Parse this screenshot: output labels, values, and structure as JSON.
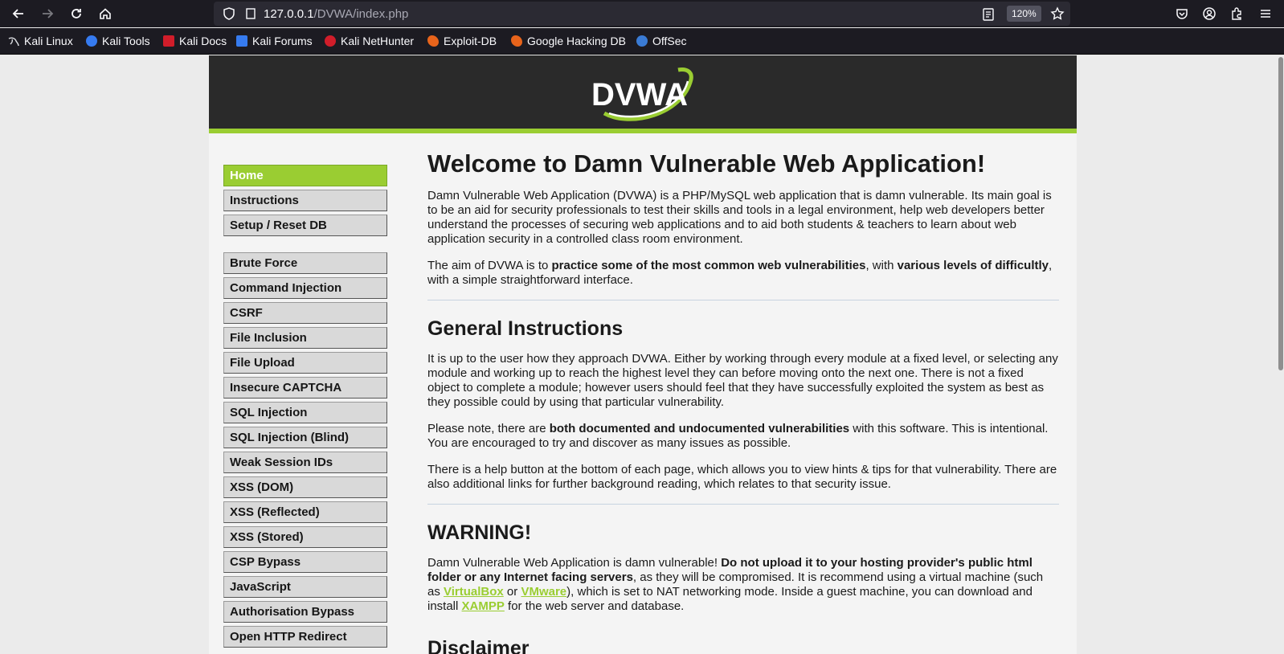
{
  "browser": {
    "url_host": "127.0.0.1",
    "url_path": "/DVWA/index.php",
    "zoom": "120%",
    "bookmarks": [
      {
        "label": "Kali Linux",
        "icon": "kali-dragon-icon"
      },
      {
        "label": "Kali Tools",
        "icon": "kali-tools-icon"
      },
      {
        "label": "Kali Docs",
        "icon": "kali-docs-icon"
      },
      {
        "label": "Kali Forums",
        "icon": "kali-forums-icon"
      },
      {
        "label": "Kali NetHunter",
        "icon": "nethunter-icon"
      },
      {
        "label": "Exploit-DB",
        "icon": "exploit-db-icon"
      },
      {
        "label": "Google Hacking DB",
        "icon": "ghdb-icon"
      },
      {
        "label": "OffSec",
        "icon": "offsec-icon"
      }
    ]
  },
  "logo_text": "DVWA",
  "colors": {
    "accent": "#9acd32",
    "header": "#2a2a2a"
  },
  "menu": {
    "top": [
      "Home",
      "Instructions",
      "Setup / Reset DB"
    ],
    "modules": [
      "Brute Force",
      "Command Injection",
      "CSRF",
      "File Inclusion",
      "File Upload",
      "Insecure CAPTCHA",
      "SQL Injection",
      "SQL Injection (Blind)",
      "Weak Session IDs",
      "XSS (DOM)",
      "XSS (Reflected)",
      "XSS (Stored)",
      "CSP Bypass",
      "JavaScript",
      "Authorisation Bypass",
      "Open HTTP Redirect"
    ]
  },
  "main": {
    "title": "Welcome to Damn Vulnerable Web Application!",
    "intro": "Damn Vulnerable Web Application (DVWA) is a PHP/MySQL web application that is damn vulnerable. Its main goal is to be an aid for security professionals to test their skills and tools in a legal environment, help web developers better understand the processes of securing web applications and to aid both students & teachers to learn about web application security in a controlled class room environment.",
    "aim": {
      "t1": "The aim of DVWA is to ",
      "b1": "practice some of the most common web vulnerabilities",
      "t2": ", with ",
      "b2": "various levels of difficultly",
      "t3": ", with a simple straightforward interface."
    },
    "general_heading": "General Instructions",
    "general_p1": "It is up to the user how they approach DVWA. Either by working through every module at a fixed level, or selecting any module and working up to reach the highest level they can before moving onto the next one. There is not a fixed object to complete a module; however users should feel that they have successfully exploited the system as best as they possible could by using that particular vulnerability.",
    "general_p2": {
      "t1": "Please note, there are ",
      "b1": "both documented and undocumented vulnerabilities",
      "t2": " with this software. This is intentional. You are encouraged to try and discover as many issues as possible."
    },
    "general_p3": "There is a help button at the bottom of each page, which allows you to view hints & tips for that vulnerability. There are also additional links for further background reading, which relates to that security issue.",
    "warning_heading": "WARNING!",
    "warning": {
      "t1": "Damn Vulnerable Web Application is damn vulnerable! ",
      "b1": "Do not upload it to your hosting provider's public html folder or any Internet facing servers",
      "t2": ", as they will be compromised. It is recommend using a virtual machine (such as ",
      "l1": "VirtualBox",
      "t3": " or ",
      "l2": "VMware",
      "t4": "), which is set to NAT networking mode. Inside a guest machine, you can download and install ",
      "l3": "XAMPP",
      "t5": " for the web server and database."
    },
    "disclaimer_heading": "Disclaimer"
  }
}
